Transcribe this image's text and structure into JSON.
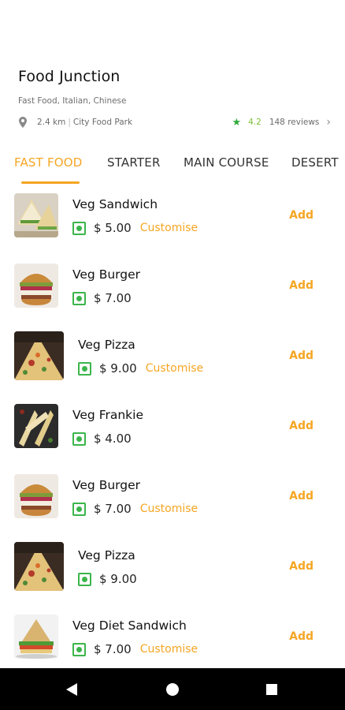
{
  "restaurant": {
    "name": "Food Junction",
    "cuisines": "Fast Food, Italian, Chinese",
    "distance": "2.4 km",
    "location": "City Food Park",
    "rating": "4.2",
    "reviews": "148 reviews"
  },
  "tabs": [
    {
      "label": "FAST FOOD"
    },
    {
      "label": "STARTER"
    },
    {
      "label": "MAIN COURSE"
    },
    {
      "label": "DESERT"
    }
  ],
  "active_tab": "FAST FOOD",
  "items": [
    {
      "name": "Veg Sandwich",
      "price": "$ 5.00",
      "customise": "Customise",
      "add": "Add",
      "image": "sandwich"
    },
    {
      "name": "Veg Burger",
      "price": "$ 7.00",
      "customise": "",
      "add": "Add",
      "image": "burger"
    },
    {
      "name": "Veg Pizza",
      "price": "$ 9.00",
      "customise": "Customise",
      "add": "Add",
      "image": "pizza"
    },
    {
      "name": "Veg Frankie",
      "price": "$ 4.00",
      "customise": "",
      "add": "Add",
      "image": "frankie"
    },
    {
      "name": "Veg Burger",
      "price": "$ 7.00",
      "customise": "Customise",
      "add": "Add",
      "image": "burger"
    },
    {
      "name": "Veg Pizza",
      "price": "$ 9.00",
      "customise": "",
      "add": "Add",
      "image": "pizza"
    },
    {
      "name": "Veg Diet Sandwich",
      "price": "$ 7.00",
      "customise": "Customise",
      "add": "Add",
      "image": "diet-sandwich"
    }
  ],
  "colors": {
    "accent": "#f5a623",
    "veg_green": "#3bb54a",
    "star_green": "#2eaa3c",
    "navbar": "#000000"
  },
  "icons": {
    "location": "location-pin-icon",
    "rating": "star-icon",
    "chevron": "chevron-right-icon",
    "veg": "veg-indicator-icon",
    "nav_back": "back-triangle-icon",
    "nav_home": "home-circle-icon",
    "nav_recents": "recents-square-icon"
  }
}
